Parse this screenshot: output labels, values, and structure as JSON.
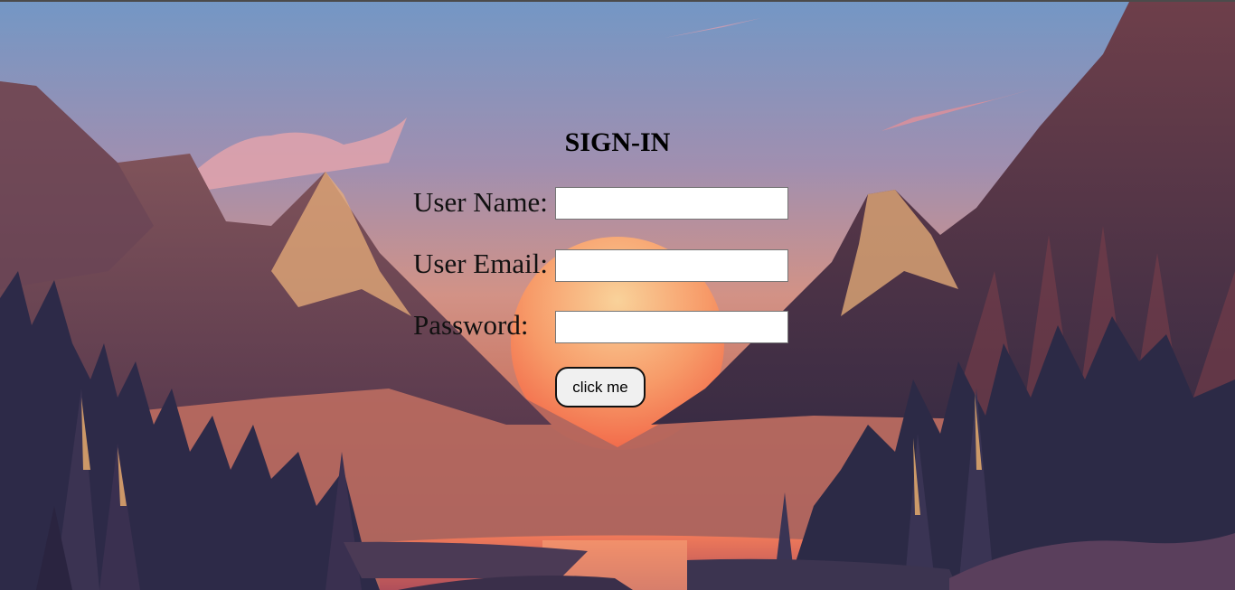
{
  "form": {
    "title": "SIGN-IN",
    "fields": [
      {
        "label": "User Name:",
        "value": "",
        "placeholder": ""
      },
      {
        "label": "User Email:",
        "value": "",
        "placeholder": ""
      },
      {
        "label": "Password:",
        "value": "",
        "placeholder": ""
      }
    ],
    "submit_label": "click me"
  },
  "colors": {
    "sky_top": "#7597c4",
    "sky_mid": "#c08f8f",
    "sun": "#f8b06e",
    "mountain": "#7d4a4a",
    "forest": "#2c2a45",
    "field_bg": "#ffffff",
    "button_bg": "#f0f0f0"
  },
  "icons": []
}
